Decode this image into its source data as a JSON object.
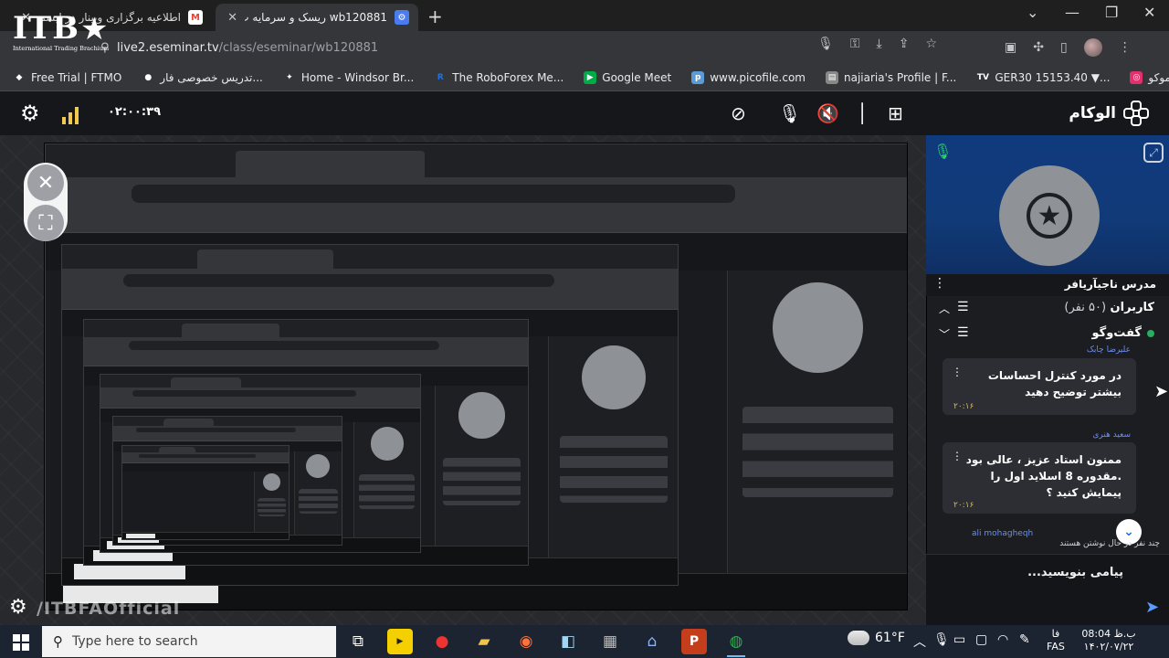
{
  "browser": {
    "tabs": [
      {
        "title": "اطلاعیه برگزاری وبینار در ایسمنار",
        "favicon": "gmail-icon",
        "color": "#ea4335"
      },
      {
        "title": "wb120881 ریسک و سرمایه ت",
        "favicon": "eseminar-icon",
        "color": "#4a7cf0"
      }
    ],
    "new_tab": "+",
    "url_host": "live2.eseminar.tv",
    "url_path": "/class/eseminar/wb120881",
    "bookmarks": [
      {
        "label": "Free Trial | FTMO",
        "icon": "ftmo-icon",
        "color": "#ffffff"
      },
      {
        "label": "تدریس خصوصی فار...",
        "icon": "circle-icon",
        "color": "#ffffff"
      },
      {
        "label": "Home - Windsor Br...",
        "icon": "windsor-icon",
        "color": "#ffffff"
      },
      {
        "label": "The RoboForex Me...",
        "icon": "roboforex-icon",
        "color": "#1a73e8"
      },
      {
        "label": "Google Meet",
        "icon": "google-meet-icon",
        "color": "#00ac47"
      },
      {
        "label": "www.picofile.com",
        "icon": "picofile-icon",
        "color": "#5b9bd5"
      },
      {
        "label": "najiaria's Profile | F...",
        "icon": "profile-icon",
        "color": "#888888"
      },
      {
        "label": "GER30 15153.40 ▼...",
        "icon": "tradingview-icon",
        "color": "#ffffff"
      },
      {
        "label": "ناجی آریافر|ایچیموکو...",
        "icon": "instagram-icon",
        "color": "#e1306c"
      }
    ]
  },
  "logo": {
    "text": "ITB",
    "star": "★",
    "subtitle": "International Trading Brachium"
  },
  "app": {
    "brand": "الوکام",
    "timer": "۰۲:۰۰:۳۹",
    "stage_watermark": "/ITBFAOfficial"
  },
  "side": {
    "presenter_name": "مدرس ناجیآریافر",
    "users_label": "کاربران",
    "users_count": "(۵۰ نفر)",
    "chat_label": "گفت‌وگو",
    "messages": [
      {
        "sender": "علیرضا چابک",
        "text": "در مورد کنترل احساسات بیشتر توضیح دهید",
        "time": "۲۰:۱۶"
      },
      {
        "sender": "سعید هنری",
        "text": "ممنون استاد عزیز ، عالی بود .مقدوره 8 اسلاید اول را پیمایش کنید ؟",
        "time": "۲۰:۱۶"
      }
    ],
    "next_sender": "ali mohagheqh",
    "typing_text": "چند نفر در حال نوشتن هستند",
    "input_placeholder": "پیامی بنویسید..."
  },
  "taskbar": {
    "search_placeholder": "Type here to search",
    "temperature": "61°F",
    "lang_top": "فا",
    "lang_bottom": "FAS",
    "time": "ب.ظ 08:04",
    "date": "۱۴۰۲/۰۷/۲۲"
  },
  "colors": {
    "accent_blue": "#0f3a7d",
    "online_green": "#27ae60",
    "timestamp_gold": "#e2b93b",
    "sender_blue": "#6b8ff0"
  }
}
